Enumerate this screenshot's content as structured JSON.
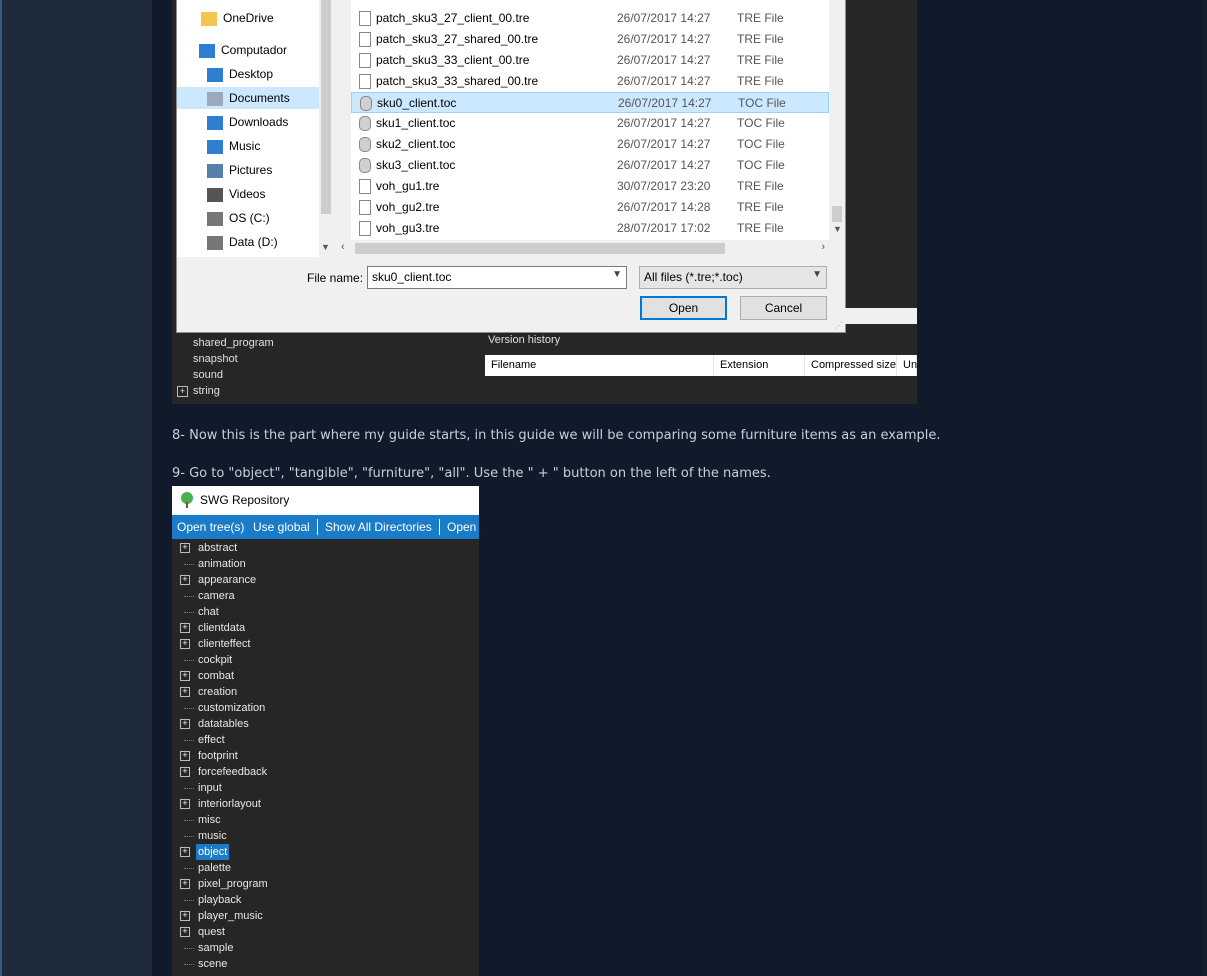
{
  "dialog": {
    "nav_items": [
      {
        "label": "OneDrive",
        "icon": "folder-icon"
      },
      {
        "label": "Computador",
        "icon": "computer-icon"
      },
      {
        "label": "Desktop",
        "icon": "desktop-icon"
      },
      {
        "label": "Documents",
        "icon": "documents-icon",
        "selected": true
      },
      {
        "label": "Downloads",
        "icon": "downloads-icon"
      },
      {
        "label": "Music",
        "icon": "music-icon"
      },
      {
        "label": "Pictures",
        "icon": "pictures-icon"
      },
      {
        "label": "Videos",
        "icon": "videos-icon"
      },
      {
        "label": "OS (C:)",
        "icon": "drive-icon"
      },
      {
        "label": "Data (D:)",
        "icon": "drive-icon"
      }
    ],
    "files": [
      {
        "name": "patch_sku3_27_client_00.tre",
        "date": "26/07/2017 14:27",
        "type": "TRE File"
      },
      {
        "name": "patch_sku3_27_shared_00.tre",
        "date": "26/07/2017 14:27",
        "type": "TRE File"
      },
      {
        "name": "patch_sku3_33_client_00.tre",
        "date": "26/07/2017 14:27",
        "type": "TRE File"
      },
      {
        "name": "patch_sku3_33_shared_00.tre",
        "date": "26/07/2017 14:27",
        "type": "TRE File"
      },
      {
        "name": "sku0_client.toc",
        "date": "26/07/2017 14:27",
        "type": "TOC File",
        "selected": true
      },
      {
        "name": "sku1_client.toc",
        "date": "26/07/2017 14:27",
        "type": "TOC File"
      },
      {
        "name": "sku2_client.toc",
        "date": "26/07/2017 14:27",
        "type": "TOC File"
      },
      {
        "name": "sku3_client.toc",
        "date": "26/07/2017 14:27",
        "type": "TOC File"
      },
      {
        "name": "voh_gu1.tre",
        "date": "30/07/2017 23:20",
        "type": "TRE File"
      },
      {
        "name": "voh_gu2.tre",
        "date": "26/07/2017 14:28",
        "type": "TRE File"
      },
      {
        "name": "voh_gu3.tre",
        "date": "28/07/2017 17:02",
        "type": "TRE File"
      }
    ],
    "file_name_label": "File name:",
    "file_name_value": "sku0_client.toc",
    "filter_value": "All files (*.tre;*.toc)",
    "open_label": "Open",
    "cancel_label": "Cancel"
  },
  "background_app": {
    "tree_items": [
      {
        "label": "shared_program",
        "expandable": false
      },
      {
        "label": "snapshot",
        "expandable": false
      },
      {
        "label": "sound",
        "expandable": false
      },
      {
        "label": "string",
        "expandable": true
      }
    ],
    "version_history_label": "Version history",
    "table_columns": [
      "Filename",
      "Extension",
      "Compressed size",
      "Un"
    ]
  },
  "guide": {
    "step8": "8- Now this is the part where my guide starts, in this guide we will be comparing some furniture items as an example.",
    "step9": "9- Go to \"object\", \"tangible\", \"furniture\", \"all\". Use the \" + \" button on the left of the names."
  },
  "repo_window": {
    "title": "SWG Repository",
    "toolbar": [
      "Open tree(s)",
      "Use global",
      "Show All Directories",
      "Open"
    ],
    "tree": [
      {
        "label": "abstract",
        "expandable": true
      },
      {
        "label": "animation",
        "expandable": false
      },
      {
        "label": "appearance",
        "expandable": true
      },
      {
        "label": "camera",
        "expandable": false
      },
      {
        "label": "chat",
        "expandable": false
      },
      {
        "label": "clientdata",
        "expandable": true
      },
      {
        "label": "clienteffect",
        "expandable": true
      },
      {
        "label": "cockpit",
        "expandable": false
      },
      {
        "label": "combat",
        "expandable": true
      },
      {
        "label": "creation",
        "expandable": true
      },
      {
        "label": "customization",
        "expandable": false
      },
      {
        "label": "datatables",
        "expandable": true
      },
      {
        "label": "effect",
        "expandable": false
      },
      {
        "label": "footprint",
        "expandable": true
      },
      {
        "label": "forcefeedback",
        "expandable": true
      },
      {
        "label": "input",
        "expandable": false
      },
      {
        "label": "interiorlayout",
        "expandable": true
      },
      {
        "label": "misc",
        "expandable": false
      },
      {
        "label": "music",
        "expandable": false
      },
      {
        "label": "object",
        "expandable": true,
        "selected": true
      },
      {
        "label": "palette",
        "expandable": false
      },
      {
        "label": "pixel_program",
        "expandable": true
      },
      {
        "label": "playback",
        "expandable": false
      },
      {
        "label": "player_music",
        "expandable": true
      },
      {
        "label": "quest",
        "expandable": true
      },
      {
        "label": "sample",
        "expandable": false
      },
      {
        "label": "scene",
        "expandable": false
      }
    ]
  },
  "colors": {
    "accent": "#1a7bc8",
    "selection": "#cce8ff",
    "page_bg": "#111a2a"
  }
}
